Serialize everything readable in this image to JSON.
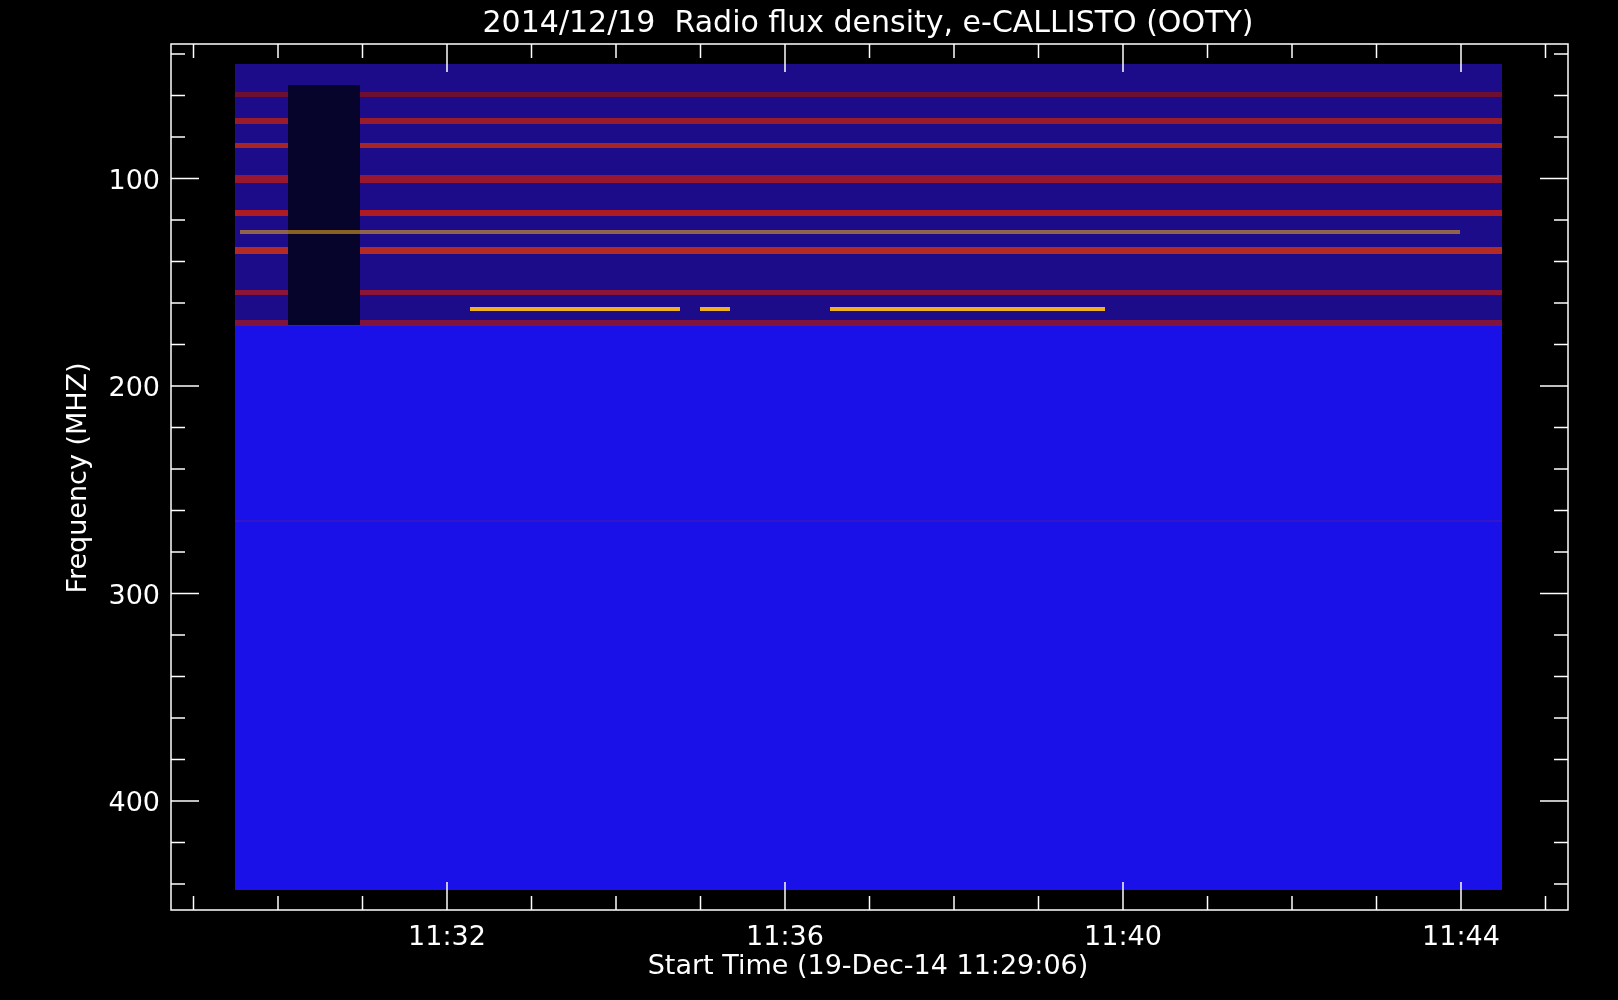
{
  "plot": {
    "title": "2014/12/19  Radio flux density, e-CALLISTO (OOTY)",
    "ylabel": "Frequency (MHZ)",
    "xlabel": "Start Time (19-Dec-14 11:29:06)",
    "yticks": [
      "100",
      "200",
      "300",
      "400"
    ],
    "xticks": [
      "11:32",
      "11:36",
      "11:40",
      "11:44"
    ]
  }
}
